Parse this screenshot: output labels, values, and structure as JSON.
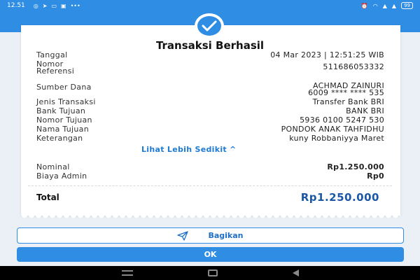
{
  "status_bar": {
    "time": "12.51",
    "left_icons": [
      "whatsapp-icon",
      "telegram-icon",
      "message-icon",
      "news-icon",
      "signal-icon"
    ],
    "battery": "99"
  },
  "receipt": {
    "title": "Transaksi Berhasil",
    "rows": [
      {
        "label": "Tanggal",
        "value": "04 Mar 2023 | 12:51:25 WIB"
      },
      {
        "label": "Nomor Referensi",
        "value": "511686053332"
      },
      {
        "label": "Sumber Dana",
        "value": "ACHMAD ZAINURI",
        "value2": "6009 **** **** 535"
      },
      {
        "label": "Jenis Transaksi",
        "value": "Transfer Bank BRI"
      },
      {
        "label": "Bank Tujuan",
        "value": "BANK BRI"
      },
      {
        "label": "Nomor Tujuan",
        "value": "5936 0100 5247 530"
      },
      {
        "label": "Nama Tujuan",
        "value": "PONDOK ANAK TAHFIDHU"
      },
      {
        "label": "Keterangan",
        "value": "kuny Robbaniyya Maret"
      }
    ],
    "toggle_link": "Lihat Lebih Sedikit",
    "amounts": [
      {
        "label": "Nominal",
        "value": "Rp1.250.000"
      },
      {
        "label": "Biaya Admin",
        "value": "Rp0"
      }
    ],
    "total": {
      "label": "Total",
      "value": "Rp1.250.000"
    }
  },
  "actions": {
    "share_label": "Bagikan",
    "ok_label": "OK"
  },
  "colors": {
    "primary": "#2f8de4",
    "total_value": "#1a58a6",
    "link": "#1f7ad4"
  }
}
